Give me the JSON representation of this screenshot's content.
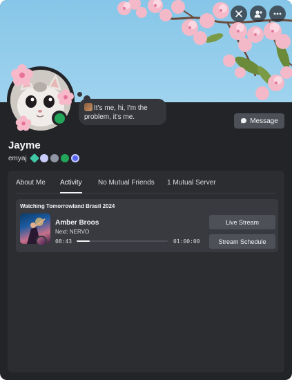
{
  "profile": {
    "display_name": "Jayme",
    "username": "emyaj",
    "status": "online",
    "custom_status": "It's me, hi, I'm the problem, it's me.",
    "badges": [
      {
        "icon": "hypesquad-badge-icon",
        "color": "#3fc7a6"
      },
      {
        "icon": "nitro-badge-icon",
        "color": "#c9cdfb"
      },
      {
        "icon": "server-boost-badge-icon",
        "color": "#8f95a3"
      },
      {
        "icon": "quest-badge-icon",
        "color": "#23a55a"
      },
      {
        "icon": "active-developer-badge-icon",
        "color": "#5865f2"
      }
    ]
  },
  "header_buttons": {
    "icons": [
      "voice-call-icon",
      "add-friend-icon",
      "more-options-icon"
    ]
  },
  "actions": {
    "message_label": "Message"
  },
  "tabs": [
    {
      "label": "About Me",
      "active": false
    },
    {
      "label": "Activity",
      "active": true
    },
    {
      "label": "No Mutual Friends",
      "active": false
    },
    {
      "label": "1 Mutual Server",
      "active": false
    }
  ],
  "activity": {
    "title": "Watching Tomorrowland Brasil 2024",
    "artist": "Amber Broos",
    "next": "Next: NERVO",
    "elapsed": "08:43",
    "duration": "01:00:00",
    "progress_fraction": 0.145,
    "buttons": {
      "live_stream": "Live Stream",
      "stream_schedule": "Stream Schedule"
    }
  },
  "colors": {
    "card_bg": "#232428",
    "panel_bg": "#2b2d31",
    "banner_sky": "#9fd3ee",
    "online": "#23a55a"
  }
}
